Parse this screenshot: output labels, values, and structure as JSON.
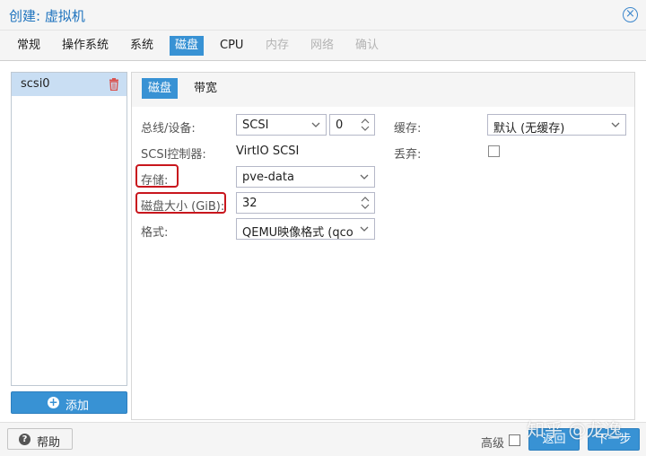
{
  "window": {
    "title": "创建: 虚拟机"
  },
  "tabs": [
    {
      "label": "常规"
    },
    {
      "label": "操作系统"
    },
    {
      "label": "系统"
    },
    {
      "label": "磁盘"
    },
    {
      "label": "CPU"
    },
    {
      "label": "内存"
    },
    {
      "label": "网络"
    },
    {
      "label": "确认"
    }
  ],
  "disk_list": {
    "items": [
      {
        "label": "scsi0"
      }
    ],
    "add_label": "添加"
  },
  "subtabs": [
    {
      "label": "磁盘"
    },
    {
      "label": "带宽"
    }
  ],
  "form": {
    "bus_label": "总线/设备:",
    "bus_value": "SCSI",
    "device_value": "0",
    "controller_label": "SCSI控制器:",
    "controller_value": "VirtIO SCSI",
    "storage_label": "存储:",
    "storage_value": "pve-data",
    "size_label": "磁盘大小 (GiB):",
    "size_value": "32",
    "format_label": "格式:",
    "format_value": "QEMU映像格式 (qco",
    "cache_label": "缓存:",
    "cache_value": "默认 (无缓存)",
    "discard_label": "丢弃:"
  },
  "footer": {
    "help_label": "帮助",
    "advanced_label": "高级",
    "back_label": "返回",
    "next_label": "下一步"
  },
  "watermark": "知乎 @龙逸",
  "colors": {
    "accent": "#3892d4",
    "highlight": "#c8161d",
    "selected_row": "#c9def3"
  }
}
